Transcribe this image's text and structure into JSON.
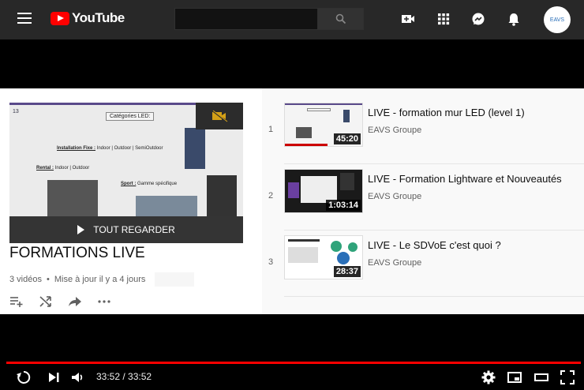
{
  "header": {
    "logo_text": "YouTube",
    "avatar_text": "EAVS"
  },
  "playlist": {
    "play_all_label": "TOUT REGARDER",
    "title": "FORMATIONS LIVE",
    "video_count": "3 vidéos",
    "separator": "•",
    "updated": "Mise à jour il y a 4 jours",
    "slide": {
      "number": "13",
      "heading": "Catégories LED:",
      "line1_label": "Installation Fixe :",
      "line1_text": " Indoor | Outdoor | SemiOutdoor",
      "line2_label": "Rental :",
      "line2_text": " Indoor | Outdoor",
      "line3_label": "Sport :",
      "line3_text": " Gamme spécifique"
    }
  },
  "videos": [
    {
      "index": "1",
      "title": "LIVE - formation mur LED (level 1)",
      "channel": "EAVS Groupe",
      "duration": "45:20"
    },
    {
      "index": "2",
      "title": "LIVE - Formation Lightware et Nouveautés",
      "channel": "EAVS Groupe",
      "duration": "1:03:14"
    },
    {
      "index": "3",
      "title": "LIVE - Le SDVoE c'est quoi ?",
      "channel": "EAVS Groupe",
      "duration": "28:37"
    }
  ],
  "player": {
    "time": "33:52 / 33:52",
    "progress_fraction": 1.0,
    "accent_color": "#ff0000"
  }
}
